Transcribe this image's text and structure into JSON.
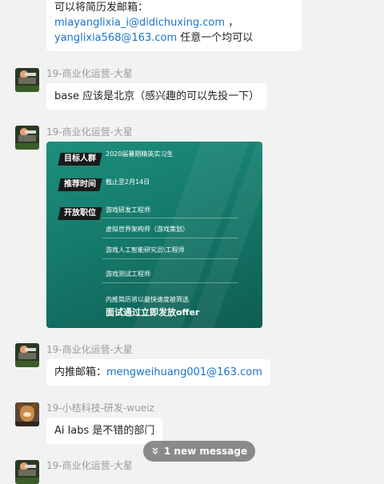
{
  "messages": [
    {
      "id": "m0",
      "lines": [
        {
          "text": "可以将简历发邮箱："
        },
        {
          "link": "miayanglixia_i@didichuxing.com",
          "suffix": "   ，"
        },
        {
          "link": "yanglixia568@163.com",
          "suffix": " 任意一个均可以"
        }
      ]
    },
    {
      "id": "m1",
      "sender": "19-商业化运营-大星",
      "text": "base 应该是北京（感兴趣的可以先投一下）"
    },
    {
      "id": "m2",
      "sender": "19-商业化运营-大星",
      "poster": {
        "tag1": "目标人群",
        "target": "2020届暑期精英实习生",
        "tag2": "推荐时间",
        "deadline": "截止至2月14日",
        "tag3": "开放职位",
        "positions": [
          "游戏研发工程师",
          "虚拟世界架构师（游戏策划）",
          "游戏人工智能研究员\\工程师",
          "游戏测试工程师"
        ],
        "footer1": "内推简历将以最快速度被筛选",
        "footer2": "面试通过立即发放offer",
        "bg_color": "#157a6b"
      }
    },
    {
      "id": "m3",
      "sender": "19-商业化运营-大星",
      "prefix": "内推邮箱：",
      "link": "mengweihuang001@163.com"
    },
    {
      "id": "m4",
      "sender": "19-小桔科技-研发-wueiz",
      "text": "Ai labs 是不错的部门"
    },
    {
      "id": "m5",
      "sender": "19-商业化运营-大星"
    }
  ],
  "new_message_pill": {
    "label": "1 new message",
    "icon": "double-chevron-down-icon"
  },
  "colors": {
    "link": "#1a73c8",
    "background": "#f2f2f2",
    "bubble": "#ffffff",
    "sender": "#9a9a9a"
  }
}
